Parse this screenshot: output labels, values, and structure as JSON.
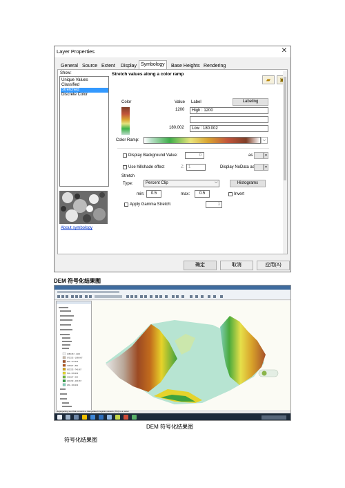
{
  "dialog": {
    "title": "Layer Properties",
    "tabs": [
      "General",
      "Source",
      "Extent",
      "Display",
      "Symbology",
      "Base Heights",
      "Rendering"
    ],
    "active_tab": "Symbology",
    "show_label": "Show:",
    "show_items": [
      "Unique Values",
      "Classified",
      "Stretched",
      "Discrete Color"
    ],
    "selected_show_item": "Stretched",
    "about_link": "About symbology",
    "heading": "Stretch values along a color ramp",
    "color_col": "Color",
    "value_col": "Value",
    "label_col": "Label",
    "labeling_button": "Labeling",
    "high_value": "1200",
    "high_label": "High : 1200",
    "low_value": "180.002",
    "low_label": "Low : 180.002",
    "color_ramp_label": "Color Ramp:",
    "display_background_label": "Display Background Value:",
    "background_value": "0",
    "as_label": "as",
    "hillshade_label": "Use hillshade effect",
    "z_label": "Z:",
    "z_value": "1",
    "nodata_label": "Display NoData as",
    "stretch_group": "Stretch",
    "type_label": "Type:",
    "type_value": "Percent Clip",
    "histograms_button": "Histograms",
    "min_label": "min:",
    "min_value": "0.5",
    "max_label": "max:",
    "max_value": "0.5",
    "invert_label": "Invert",
    "gamma_label": "Apply Gamma Stretch:",
    "gamma_value": "1",
    "ok_button": "确定",
    "cancel_button": "取消",
    "apply_button": "应用(A)"
  },
  "captions": {
    "caption1": "DEM 符号化结果图",
    "caption2": "DEM 符号化结果图",
    "caption3": "符号化结果图"
  },
  "arcmap": {
    "status_text": "Reprojecting tool that converts a triangulated irregular network (TIN) to a raster.",
    "toc_legend": [
      {
        "label": "1086.667 - 1200",
        "color": "#f2f2f2"
      },
      {
        "label": "973.333 - 1086.667",
        "color": "#c7b8a8"
      },
      {
        "label": "860 - 973.333",
        "color": "#a8552a"
      },
      {
        "label": "746.667 - 860",
        "color": "#b3571f"
      },
      {
        "label": "633.333 - 746.667",
        "color": "#d0a018"
      },
      {
        "label": "520 - 633.333",
        "color": "#e7d72a"
      },
      {
        "label": "406.667 - 520",
        "color": "#6fb83a"
      },
      {
        "label": "293.333 - 406.667",
        "color": "#2e9a3e"
      },
      {
        "label": "180 - 293.333",
        "color": "#7ecfb8"
      }
    ]
  }
}
